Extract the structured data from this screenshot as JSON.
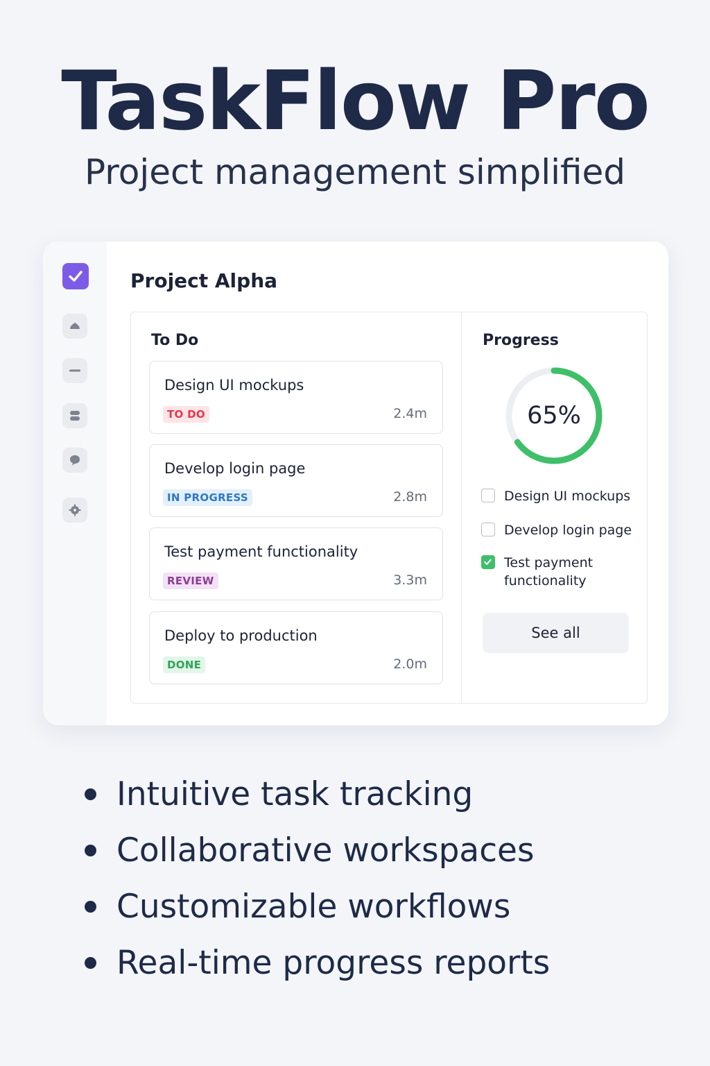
{
  "hero": {
    "title": "TaskFlow Pro",
    "subtitle": "Project management simplified"
  },
  "sidebar": {
    "logo_icon": "checkmark-icon",
    "items": [
      {
        "icon": "home-icon"
      },
      {
        "icon": "minus-icon"
      },
      {
        "icon": "database-icon"
      },
      {
        "icon": "chat-icon"
      },
      {
        "icon": "gear-icon"
      }
    ]
  },
  "project": {
    "title": "Project Alpha"
  },
  "todo": {
    "title": "To Do",
    "tasks": [
      {
        "title": "Design UI mockups",
        "status": "TO DO",
        "time": "2.4m",
        "badge_bg": "#fde4e6",
        "badge_fg": "#e03a4b"
      },
      {
        "title": "Develop login page",
        "status": "IN PROGRESS",
        "time": "2.8m",
        "badge_bg": "#e3f0fc",
        "badge_fg": "#2f78c4"
      },
      {
        "title": "Test payment functionality",
        "status": "REVIEW",
        "time": "3.3m",
        "badge_bg": "#f3e1f5",
        "badge_fg": "#8c3d94"
      },
      {
        "title": "Deploy to production",
        "status": "DONE",
        "time": "2.0m",
        "badge_bg": "#e2f6e9",
        "badge_fg": "#2fa45a"
      }
    ]
  },
  "progress": {
    "title": "Progress",
    "percent": 65,
    "percent_label": "65%",
    "ring_color": "#3fbf6a",
    "track_color": "#eceef1",
    "checklist": [
      {
        "label": "Design UI mockups",
        "checked": false
      },
      {
        "label": "Develop login page",
        "checked": false
      },
      {
        "label": "Test payment functionality",
        "checked": true
      }
    ],
    "see_all_label": "See all"
  },
  "features": [
    "Intuitive task tracking",
    "Collaborative workspaces",
    "Customizable workflows",
    "Real-time progress reports"
  ]
}
